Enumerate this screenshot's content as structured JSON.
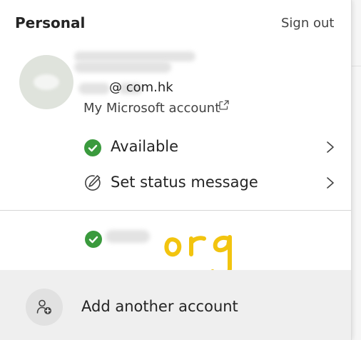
{
  "header": {
    "title": "Personal",
    "sign_out_label": "Sign out"
  },
  "account": {
    "email_visible": "@ com.hk",
    "manage_link_label": "My Microsoft account"
  },
  "status": {
    "current_label": "Available",
    "set_message_label": "Set status message",
    "available_color": "#3a9a3d"
  },
  "other_account": {
    "annotation_text": "org",
    "annotation_color": "#f2c40f"
  },
  "footer": {
    "add_account_label": "Add another account"
  },
  "icons": {
    "external_link": "external-link-icon",
    "chevron": "chevron-right-icon",
    "pencil": "edit-status-icon",
    "check": "available-check-icon",
    "add_person": "add-person-icon"
  }
}
